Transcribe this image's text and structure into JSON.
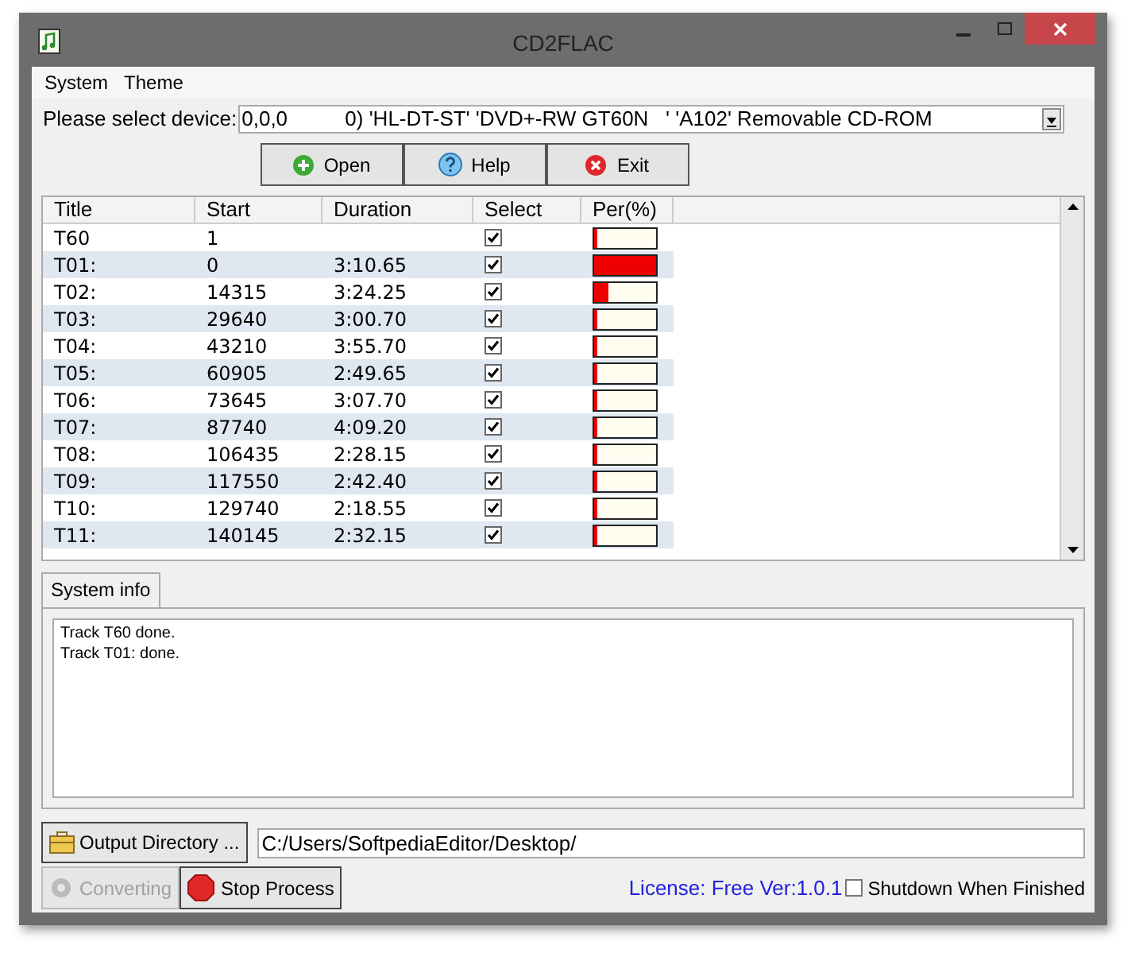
{
  "window": {
    "title": "CD2FLAC"
  },
  "menu": [
    "System",
    "Theme"
  ],
  "device": {
    "label": "Please select device:",
    "value": "0,0,0          0) 'HL-DT-ST' 'DVD+-RW GT60N   ' 'A102' Removable CD-ROM"
  },
  "buttons": [
    {
      "label": "Open",
      "kind": "open"
    },
    {
      "label": "Help",
      "kind": "help"
    },
    {
      "label": "Exit",
      "kind": "exit"
    }
  ],
  "table": {
    "columns": [
      "Title",
      "Start",
      "Duration",
      "Select",
      "Per(%)"
    ],
    "rows": [
      {
        "title": "T60",
        "start": "1",
        "duration": "",
        "checked": true,
        "level": 0.01
      },
      {
        "title": "T01:",
        "start": "0",
        "duration": "3:10.65",
        "checked": true,
        "level": 1
      },
      {
        "title": "T02:",
        "start": "14315",
        "duration": "3:24.25",
        "checked": true,
        "level": 0.22
      },
      {
        "title": "T03:",
        "start": "29640",
        "duration": "3:00.70",
        "checked": true,
        "level": 0.01
      },
      {
        "title": "T04:",
        "start": "43210",
        "duration": "3:55.70",
        "checked": true,
        "level": 0.01
      },
      {
        "title": "T05:",
        "start": "60905",
        "duration": "2:49.65",
        "checked": true,
        "level": 0.01
      },
      {
        "title": "T06:",
        "start": "73645",
        "duration": "3:07.70",
        "checked": true,
        "level": 0.01
      },
      {
        "title": "T07:",
        "start": "87740",
        "duration": "4:09.20",
        "checked": true,
        "level": 0.01
      },
      {
        "title": "T08:",
        "start": "106435",
        "duration": "2:28.15",
        "checked": true,
        "level": 0.01
      },
      {
        "title": "T09:",
        "start": "117550",
        "duration": "2:42.40",
        "checked": true,
        "level": 0.01
      },
      {
        "title": "T10:",
        "start": "129740",
        "duration": "2:18.55",
        "checked": true,
        "level": 0.01
      },
      {
        "title": "T11:",
        "start": "140145",
        "duration": "2:32.15",
        "checked": true,
        "level": 0.01
      }
    ]
  },
  "tabs": [
    {
      "label": "System info",
      "selected": true
    }
  ],
  "log": [
    "Track T60 done.",
    "Track T01: done."
  ],
  "output": {
    "button": "Output Directory ...",
    "path": "C:/Users/SoftpediaEditor/Desktop/"
  },
  "actions": [
    {
      "label": "Converting",
      "disabled": true,
      "kind": "converting"
    },
    {
      "label": "Stop Process",
      "disabled": false,
      "kind": "stop"
    }
  ],
  "license": "License: Free Ver:1.0.1",
  "shutdown": {
    "label": "Shutdown When Finished",
    "checked": false
  }
}
